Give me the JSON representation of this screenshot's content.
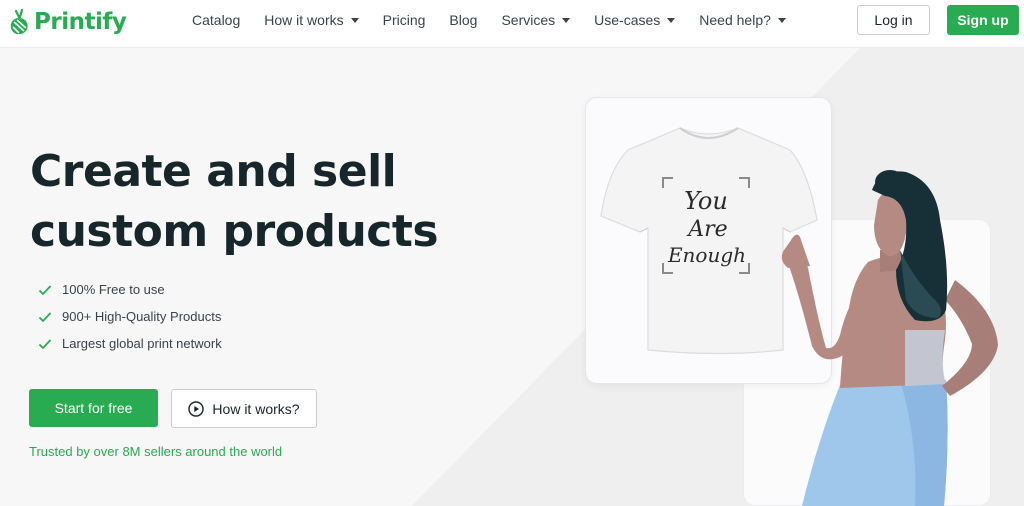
{
  "brand": {
    "name": "Printify",
    "color": "#29ab51"
  },
  "nav": {
    "items": [
      {
        "label": "Catalog",
        "dropdown": false
      },
      {
        "label": "How it works",
        "dropdown": true
      },
      {
        "label": "Pricing",
        "dropdown": false
      },
      {
        "label": "Blog",
        "dropdown": false
      },
      {
        "label": "Services",
        "dropdown": true
      },
      {
        "label": "Use-cases",
        "dropdown": true
      },
      {
        "label": "Need help?",
        "dropdown": true
      }
    ],
    "login_label": "Log in",
    "signup_label": "Sign up"
  },
  "hero": {
    "title_line1": "Create and sell",
    "title_line2": "custom products",
    "features": [
      "100% Free to use",
      "900+ High-Quality Products",
      "Largest global print network"
    ],
    "start_label": "Start for free",
    "how_label": "How it works?",
    "trusted_text": "Trusted by over 8M sellers around the world"
  },
  "tshirt": {
    "print_text": [
      "You",
      "Are",
      "Enough"
    ]
  },
  "icons": {
    "feature": "check-icon",
    "how": "play-circle-icon"
  }
}
